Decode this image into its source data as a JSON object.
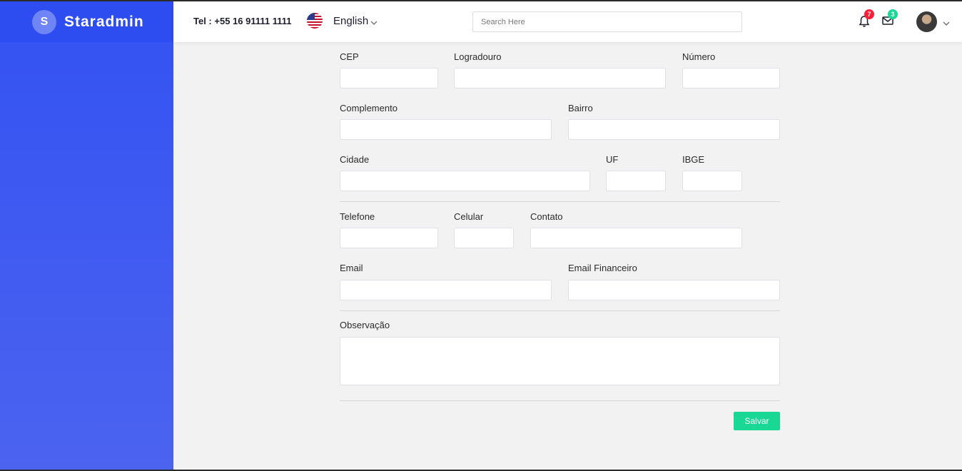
{
  "brand": {
    "logo_letter": "S",
    "name": "Staradmin"
  },
  "topbar": {
    "tel": "Tel : +55 16 91111 1111",
    "language": "English",
    "search_placeholder": "Search Here",
    "notifications_count": "7",
    "messages_count": "3"
  },
  "form": {
    "cep": {
      "label": "CEP",
      "value": ""
    },
    "logradouro": {
      "label": "Logradouro",
      "value": ""
    },
    "numero": {
      "label": "Número",
      "value": ""
    },
    "complemento": {
      "label": "Complemento",
      "value": ""
    },
    "bairro": {
      "label": "Bairro",
      "value": ""
    },
    "cidade": {
      "label": "Cidade",
      "value": ""
    },
    "uf": {
      "label": "UF",
      "value": ""
    },
    "ibge": {
      "label": "IBGE",
      "value": ""
    },
    "telefone": {
      "label": "Telefone",
      "value": ""
    },
    "celular": {
      "label": "Celular",
      "value": ""
    },
    "contato": {
      "label": "Contato",
      "value": ""
    },
    "email": {
      "label": "Email",
      "value": ""
    },
    "email_financeiro": {
      "label": "Email Financeiro",
      "value": ""
    },
    "observacao": {
      "label": "Observação",
      "value": ""
    },
    "save_label": "Salvar"
  },
  "colors": {
    "sidebar": "#3352f2",
    "success": "#19d895",
    "danger": "#ff1e38"
  },
  "icons": {
    "bell": "bell-icon",
    "mail": "mail-icon",
    "flag": "us-flag-icon",
    "chevron": "chevron-down-icon"
  }
}
